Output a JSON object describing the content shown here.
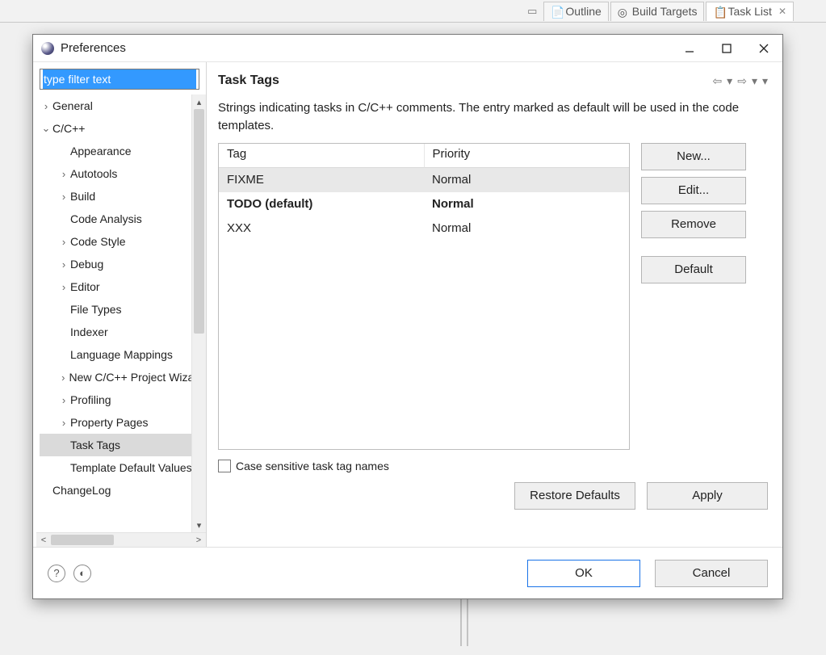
{
  "background_tabs": [
    {
      "label": "Outline",
      "active": false
    },
    {
      "label": "Build Targets",
      "active": false
    },
    {
      "label": "Task List",
      "active": true
    }
  ],
  "dialog": {
    "title": "Preferences",
    "filter_value": "type filter text",
    "tree": [
      {
        "label": "General",
        "depth": 0,
        "expandable": true,
        "expanded": false
      },
      {
        "label": "C/C++",
        "depth": 0,
        "expandable": true,
        "expanded": true
      },
      {
        "label": "Appearance",
        "depth": 1,
        "expandable": false
      },
      {
        "label": "Autotools",
        "depth": 1,
        "expandable": true,
        "expanded": false
      },
      {
        "label": "Build",
        "depth": 1,
        "expandable": true,
        "expanded": false
      },
      {
        "label": "Code Analysis",
        "depth": 1,
        "expandable": false
      },
      {
        "label": "Code Style",
        "depth": 1,
        "expandable": true,
        "expanded": false
      },
      {
        "label": "Debug",
        "depth": 1,
        "expandable": true,
        "expanded": false
      },
      {
        "label": "Editor",
        "depth": 1,
        "expandable": true,
        "expanded": false
      },
      {
        "label": "File Types",
        "depth": 1,
        "expandable": false
      },
      {
        "label": "Indexer",
        "depth": 1,
        "expandable": false
      },
      {
        "label": "Language Mappings",
        "depth": 1,
        "expandable": false
      },
      {
        "label": "New C/C++ Project Wizard",
        "depth": 1,
        "expandable": true,
        "expanded": false
      },
      {
        "label": "Profiling",
        "depth": 1,
        "expandable": true,
        "expanded": false
      },
      {
        "label": "Property Pages",
        "depth": 1,
        "expandable": true,
        "expanded": false
      },
      {
        "label": "Task Tags",
        "depth": 1,
        "expandable": false,
        "selected": true
      },
      {
        "label": "Template Default Values",
        "depth": 1,
        "expandable": false
      },
      {
        "label": "ChangeLog",
        "depth": 0,
        "expandable": false
      }
    ],
    "page_title": "Task Tags",
    "description": "Strings indicating tasks in C/C++ comments. The entry marked as default will be used in the code templates.",
    "table": {
      "headers": [
        "Tag",
        "Priority"
      ],
      "rows": [
        {
          "tag": "FIXME",
          "priority": "Normal",
          "selected": true
        },
        {
          "tag": "TODO (default)",
          "priority": "Normal",
          "default": true
        },
        {
          "tag": "XXX",
          "priority": "Normal"
        }
      ]
    },
    "side_buttons": {
      "new": "New...",
      "edit": "Edit...",
      "remove": "Remove",
      "default": "Default"
    },
    "checkbox_label": "Case sensitive task tag names",
    "checkbox_checked": false,
    "apply_buttons": {
      "restore": "Restore Defaults",
      "apply": "Apply"
    },
    "footer_buttons": {
      "ok": "OK",
      "cancel": "Cancel"
    }
  }
}
